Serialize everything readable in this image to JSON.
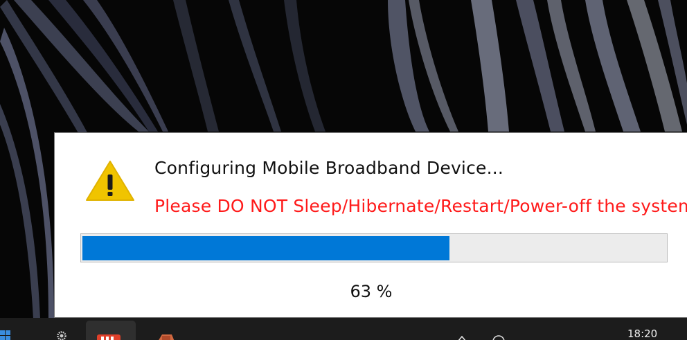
{
  "dialog": {
    "title": "Configuring Mobile Broadband Device...",
    "warning": "Please DO NOT Sleep/Hibernate/Restart/Power-off the system",
    "progress": {
      "percent": 63,
      "label": "63 %"
    },
    "warning_color": "#ff1a1a",
    "progress_color": "#0078d7"
  },
  "taskbar": {
    "clock": "18:20",
    "items": [
      "windows-icon",
      "settings-icon",
      "app-icon",
      "app-icon-2",
      "tray-chevron-icon",
      "network-icon"
    ]
  }
}
